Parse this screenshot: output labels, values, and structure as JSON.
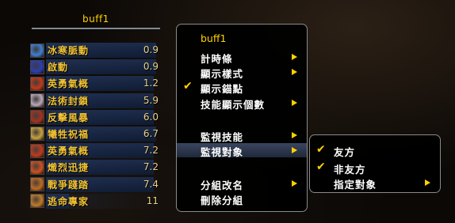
{
  "frame": {
    "title": "buff1"
  },
  "bars": [
    {
      "name": "冰寒脈動",
      "time": "0.9",
      "fill": 0.95,
      "icon_color": "#3f7fd0"
    },
    {
      "name": "啟動",
      "time": "0.9",
      "fill": 0.95,
      "icon_color": "#2a3fb8"
    },
    {
      "name": "英勇氣概",
      "time": "1.2",
      "fill": 0.93,
      "icon_color": "#c23a1c"
    },
    {
      "name": "法術封鎖",
      "time": "5.9",
      "fill": 0.93,
      "icon_color": "#b8a6b8"
    },
    {
      "name": "反擊風暴",
      "time": "6.0",
      "fill": 0.93,
      "icon_color": "#a43320"
    },
    {
      "name": "犧牲祝福",
      "time": "6.7",
      "fill": 0.95,
      "icon_color": "#c8a040"
    },
    {
      "name": "英勇氣概",
      "time": "7.2",
      "fill": 0.93,
      "icon_color": "#c23a1c"
    },
    {
      "name": "熾烈迅捷",
      "time": "7.2",
      "fill": 0.93,
      "icon_color": "#d05020"
    },
    {
      "name": "戰爭踐踏",
      "time": "7.4",
      "fill": 0.93,
      "icon_color": "#c06a22"
    },
    {
      "name": "逃命專家",
      "time": "11",
      "fill": 0.2,
      "icon_color": "#c07a28"
    }
  ],
  "menu": {
    "title": "buff1",
    "items": [
      {
        "label": "計時條",
        "arrow": true,
        "checked": false
      },
      {
        "label": "顯示樣式",
        "arrow": true,
        "checked": false
      },
      {
        "label": "顯示錨點",
        "arrow": false,
        "checked": true
      },
      {
        "label": "技能顯示個數",
        "arrow": true,
        "checked": false
      },
      {
        "label": "監視技能",
        "arrow": true,
        "checked": false
      },
      {
        "label": "監視對象",
        "arrow": true,
        "checked": false,
        "highlighted": true
      },
      {
        "label": "分組改名",
        "arrow": true,
        "checked": false
      },
      {
        "label": "刪除分組",
        "arrow": false,
        "checked": false
      }
    ]
  },
  "submenu": {
    "items": [
      {
        "label": "友方",
        "checked": true,
        "arrow": false
      },
      {
        "label": "非友方",
        "checked": true,
        "arrow": false
      },
      {
        "label": "指定對象",
        "checked": false,
        "arrow": true
      }
    ]
  },
  "colors": {
    "accent": "#ffd200",
    "bar_text": "#f1c233",
    "highlight": "#3a4560"
  }
}
